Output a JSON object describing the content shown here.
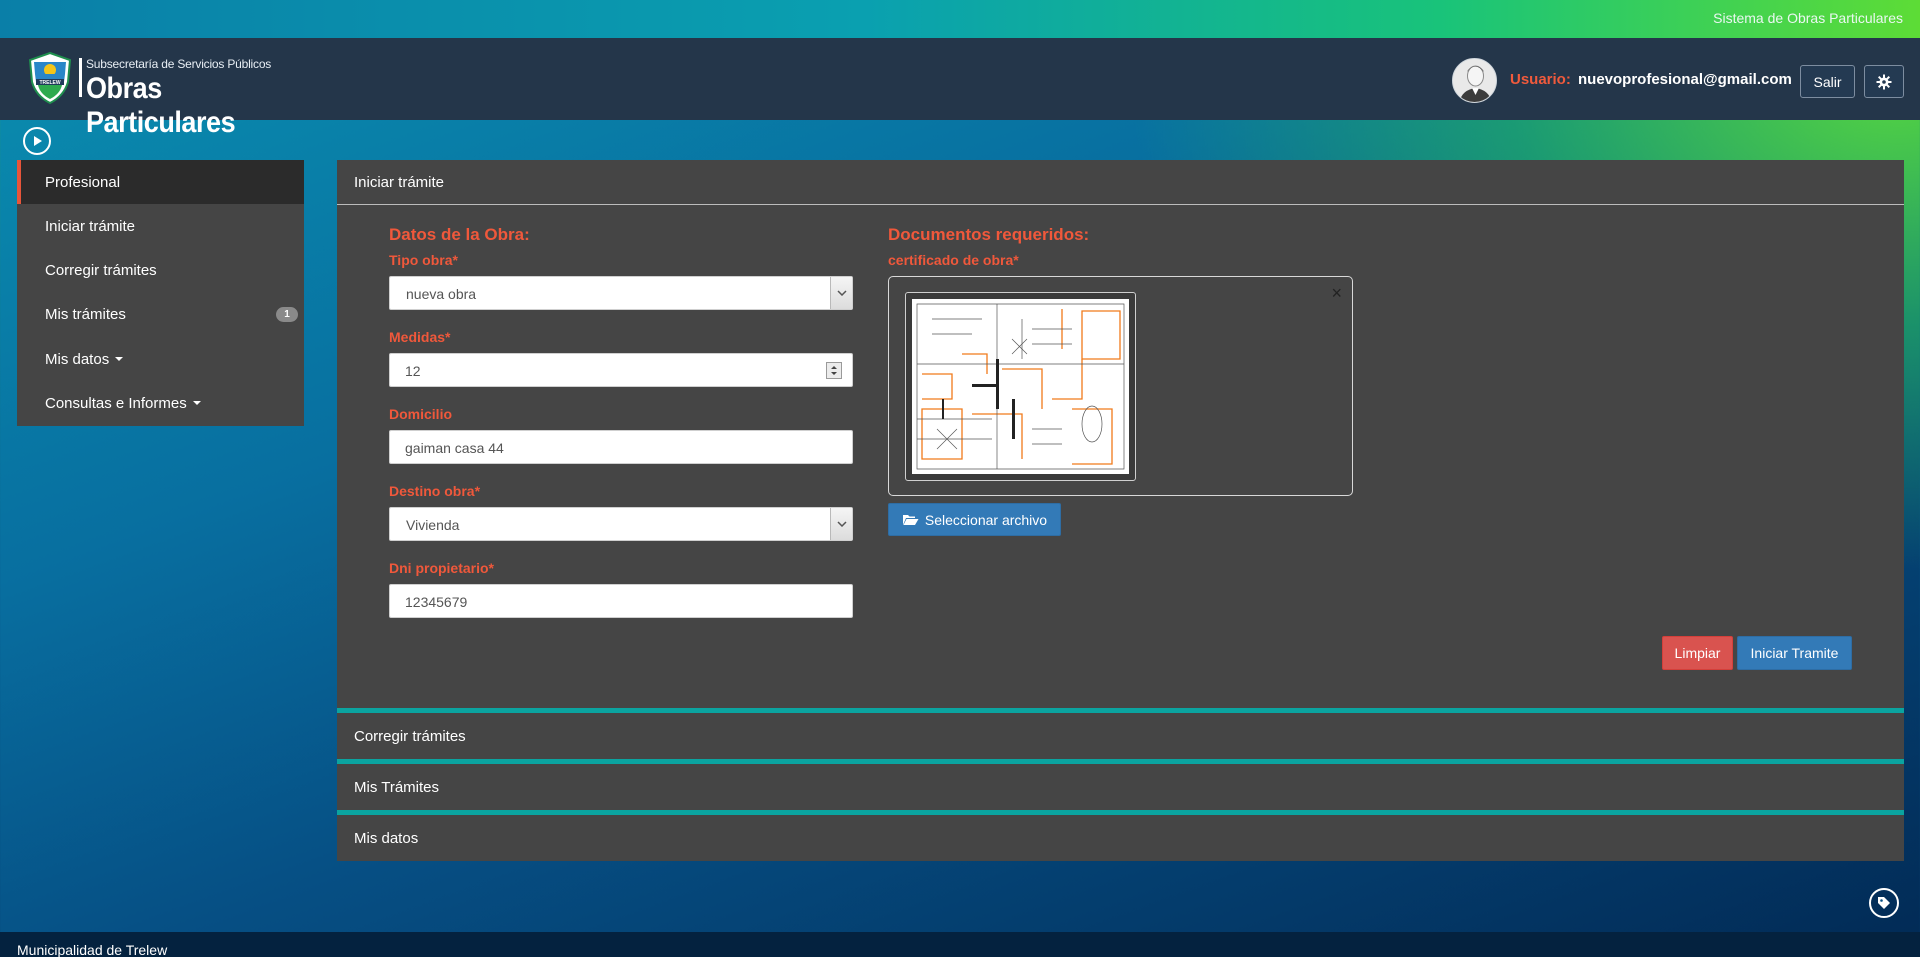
{
  "topbar": {
    "system_title": "Sistema de Obras Particulares"
  },
  "header": {
    "logo_subtitle": "Subsecretaría de Servicios Públicos",
    "logo_title": "Obras Particulares",
    "logo_badge": "TRELEW",
    "user_label": "Usuario:",
    "user_email": "nuevoprofesional@gmail.com",
    "logout_label": "Salir",
    "settings_icon": "gear-icon"
  },
  "sidebar": {
    "toggle_icon": "play-circle-icon",
    "items": [
      {
        "label": "Profesional",
        "active": true
      },
      {
        "label": "Iniciar trámite"
      },
      {
        "label": "Corregir trámites"
      },
      {
        "label": "Mis trámites",
        "badge": "1"
      },
      {
        "label": "Mis datos",
        "dropdown": true
      },
      {
        "label": "Consultas e Informes",
        "dropdown": true
      }
    ]
  },
  "main_panel": {
    "title": "Iniciar trámite",
    "obra": {
      "section_title": "Datos de la Obra:",
      "tipo_label": "Tipo obra*",
      "tipo_value": "nueva obra",
      "medidas_label": "Medidas*",
      "medidas_value": "12",
      "domicilio_label": "Domicilio",
      "domicilio_value": "gaiman casa 44",
      "destino_label": "Destino obra*",
      "destino_value": "Vivienda",
      "dni_label": "Dni propietario*",
      "dni_value": "12345679"
    },
    "documentos": {
      "section_title": "Documentos requeridos:",
      "cert_label": "certificado de obra*",
      "close_symbol": "×",
      "select_file_label": "Seleccionar archivo"
    },
    "actions": {
      "clear_label": "Limpiar",
      "submit_label": "Iniciar Tramite"
    }
  },
  "collapsed_panels": [
    {
      "title": "Corregir trámites"
    },
    {
      "title": "Mis Trámites"
    },
    {
      "title": "Mis datos"
    }
  ],
  "footer": {
    "text": "Municipalidad de Trelew"
  },
  "colors": {
    "accent_red": "#f0583b",
    "primary_blue": "#337ab7",
    "danger_red": "#d9534f",
    "panel_bg": "#454545",
    "navbar_bg": "#24364a"
  }
}
